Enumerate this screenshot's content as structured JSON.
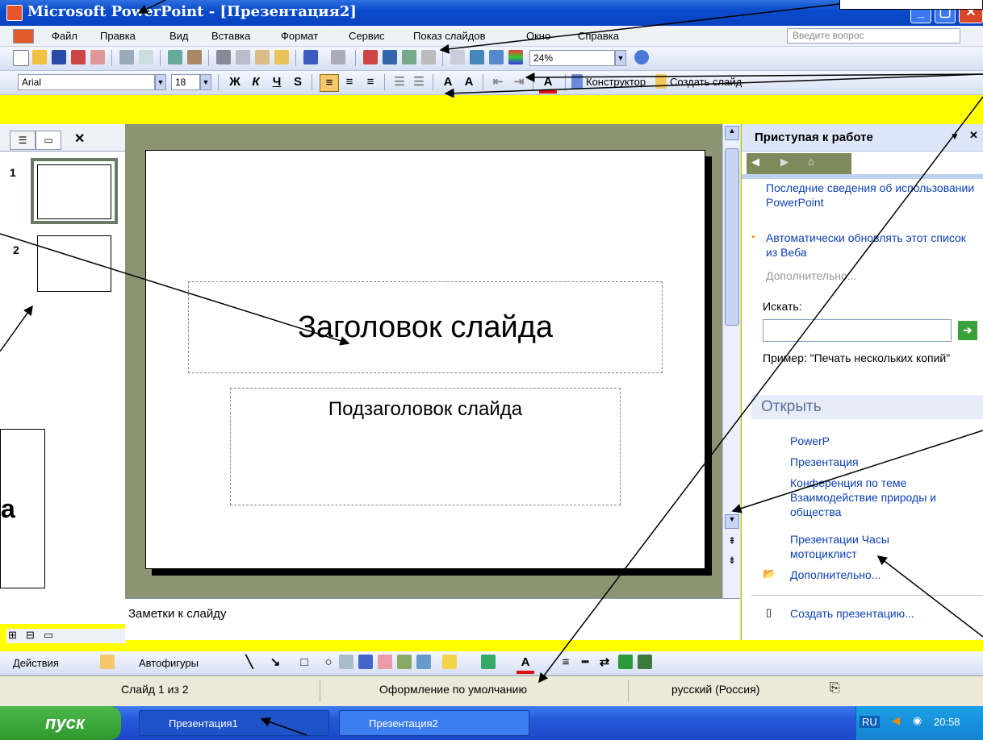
{
  "window": {
    "title": "Microsoft PowerPoint - [Презентация2]"
  },
  "menu": {
    "items": [
      "Файл",
      "Правка",
      "Вид",
      "Вставка",
      "Формат",
      "Сервис",
      "Показ слайдов",
      "Окно",
      "Справка"
    ],
    "help_placeholder": "Введите вопрос"
  },
  "standard_toolbar": {
    "zoom": "24%"
  },
  "format_toolbar": {
    "font": "Arial",
    "size": "18",
    "bold": "Ж",
    "italic": "К",
    "underline": "Ч",
    "shadow": "S",
    "designer_label": "Конструктор",
    "new_slide_label": "Создать слайд"
  },
  "slides_pane": {
    "slide_numbers": [
      "1",
      "2"
    ]
  },
  "slide": {
    "title": "Заголовок слайда",
    "subtitle": "Подзаголовок слайда"
  },
  "notes": {
    "placeholder": "Заметки к слайду"
  },
  "task_pane": {
    "title": "Приступая к работе",
    "items_top": [
      "Последние сведения об использовании PowerPoint",
      "Автоматически обновлять этот список из Веба"
    ],
    "more_top": "Дополнительно...",
    "search_label": "Искать:",
    "example": "Пример: \"Печать нескольких копий\"",
    "open_header": "Открыть",
    "open_items": [
      "PowerP",
      "Презентация",
      "Конференция по теме Взаимодействие природы и общества",
      "Презентации Часы мотоциклист"
    ],
    "more_open": "Дополнительно...",
    "create": "Создать презентацию..."
  },
  "drawing_toolbar": {
    "actions": "Действия",
    "autoshapes": "Автофигуры"
  },
  "status": {
    "slide": "Слайд 1 из 2",
    "design": "Оформление по умолчанию",
    "language": "русский (Россия)"
  },
  "taskbar": {
    "start": "пуск",
    "tasks": [
      "Презентация1",
      "Презентация2"
    ],
    "lang": "RU",
    "time": "20:58"
  },
  "callout": {
    "letter": "а"
  },
  "colors": {
    "background": "#ffff00",
    "titlebar": "#0a4ccc",
    "workspace": "#8c9472",
    "start": "#2e9a2e"
  }
}
